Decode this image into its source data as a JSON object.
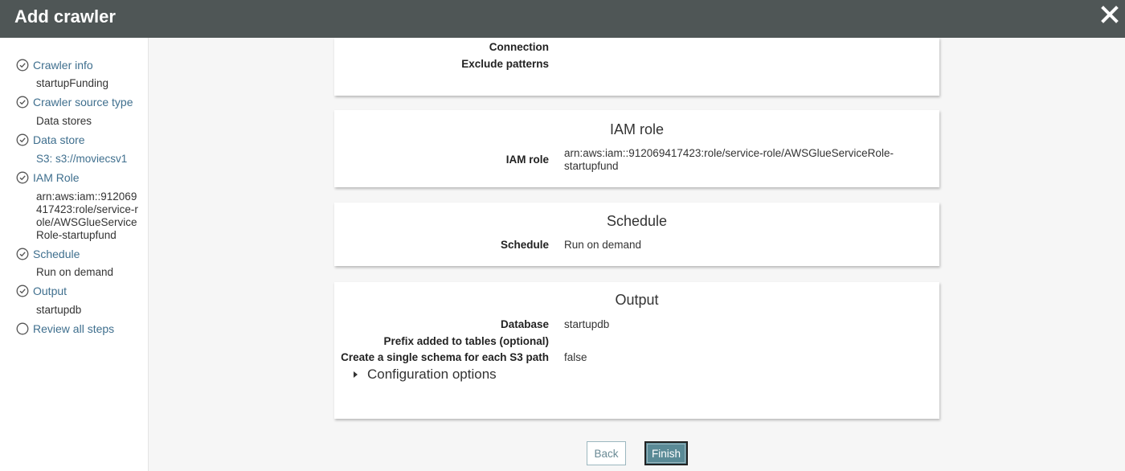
{
  "header": {
    "title": "Add crawler",
    "close_icon": "close-icon"
  },
  "sidebar": {
    "steps": [
      {
        "label": "Crawler info",
        "detail": "startupFunding",
        "state": "complete"
      },
      {
        "label": "Crawler source type",
        "detail": "Data stores",
        "state": "complete"
      },
      {
        "label": "Data store",
        "detail": "S3: s3://moviecsv1",
        "state": "complete"
      },
      {
        "label": "IAM Role",
        "detail": "arn:aws:iam::912069417423:role/service-role/AWSGlueServiceRole-startupfund",
        "state": "complete"
      },
      {
        "label": "Schedule",
        "detail": "Run on demand",
        "state": "complete"
      },
      {
        "label": "Output",
        "detail": "startupdb",
        "state": "complete"
      },
      {
        "label": "Review all steps",
        "detail": "",
        "state": "current"
      }
    ]
  },
  "datastore_card": {
    "rows": [
      {
        "key": "Connection",
        "value": ""
      },
      {
        "key": "Exclude patterns",
        "value": ""
      }
    ]
  },
  "iam_card": {
    "title": "IAM role",
    "rows": [
      {
        "key": "IAM role",
        "value": "arn:aws:iam::912069417423:role/service-role/AWSGlueServiceRole-startupfund"
      }
    ]
  },
  "schedule_card": {
    "title": "Schedule",
    "rows": [
      {
        "key": "Schedule",
        "value": "Run on demand"
      }
    ]
  },
  "output_card": {
    "title": "Output",
    "rows": [
      {
        "key": "Database",
        "value": "startupdb"
      },
      {
        "key": "Prefix added to tables (optional)",
        "value": ""
      },
      {
        "key": "Create a single schema for each S3 path",
        "value": "false"
      }
    ],
    "config_toggle": "Configuration options"
  },
  "buttons": {
    "back": "Back",
    "finish": "Finish"
  },
  "colors": {
    "header_bg": "#4f5656",
    "link": "#3f6f8e",
    "finish_bg": "#5a8a96"
  }
}
